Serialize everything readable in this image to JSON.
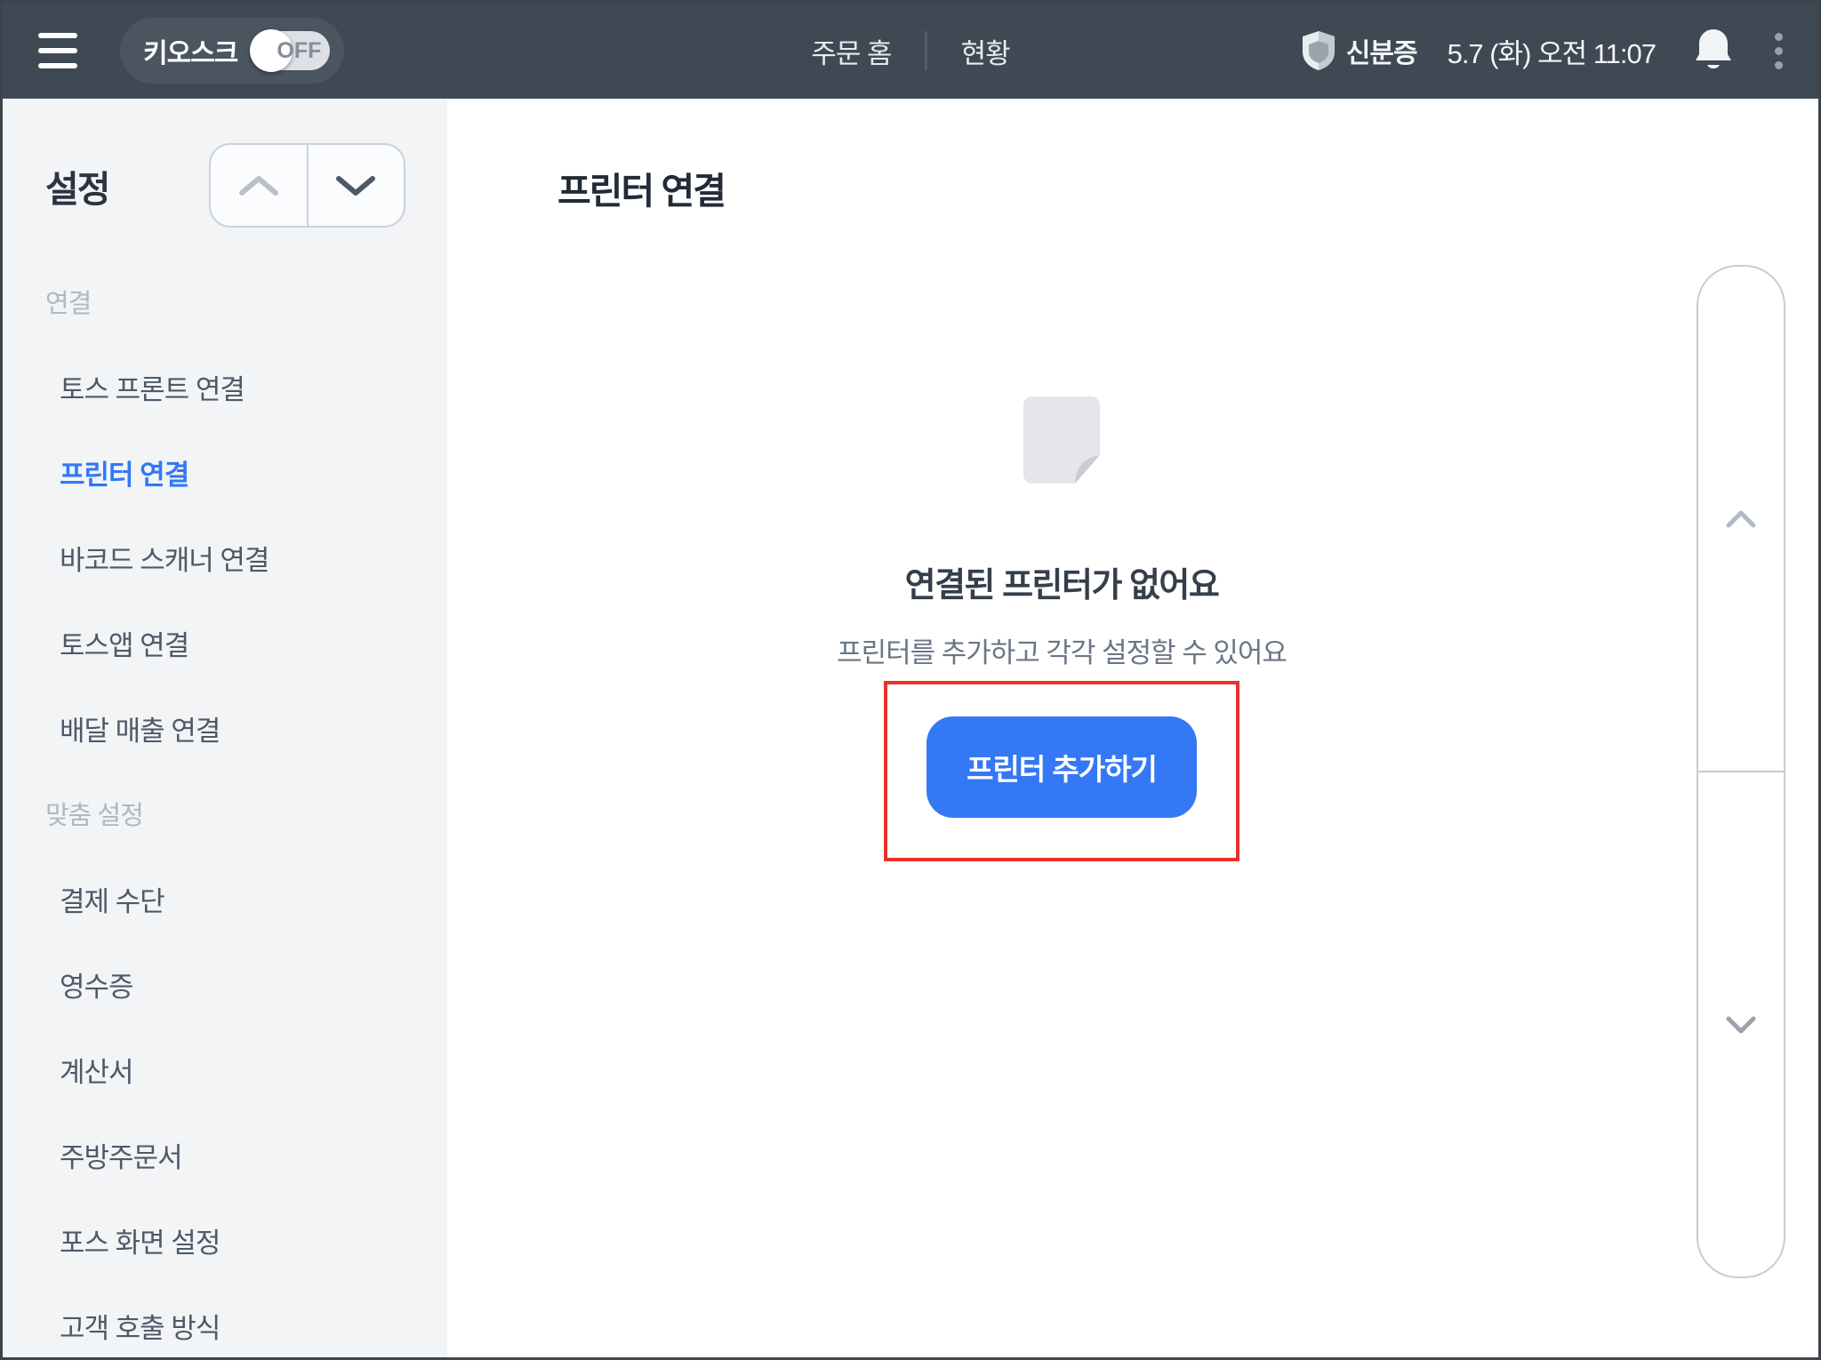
{
  "topbar": {
    "kiosk_label": "키오스크",
    "kiosk_state": "OFF",
    "nav_order_home": "주문 홈",
    "nav_status": "현황",
    "id_label": "신분증",
    "datetime": "5.7 (화) 오전 11:07"
  },
  "sidebar": {
    "title": "설정",
    "sections": [
      {
        "header": "연결",
        "items": [
          {
            "label": "토스 프론트 연결"
          },
          {
            "label": "프린터 연결",
            "active": true
          },
          {
            "label": "바코드 스캐너 연결"
          },
          {
            "label": "토스앱 연결"
          },
          {
            "label": "배달 매출 연결"
          }
        ]
      },
      {
        "header": "맞춤 설정",
        "items": [
          {
            "label": "결제 수단"
          },
          {
            "label": "영수증"
          },
          {
            "label": "계산서"
          },
          {
            "label": "주방주문서"
          },
          {
            "label": "포스 화면 설정"
          },
          {
            "label": "고객 호출 방식"
          }
        ]
      }
    ]
  },
  "main": {
    "title": "프린터 연결",
    "empty_state": {
      "heading": "연결된 프린터가 없어요",
      "subtitle": "프린터를 추가하고 각각 설정할 수 있어요",
      "add_button_label": "프린터 추가하기"
    }
  },
  "colors": {
    "topbar_bg": "#3e4954",
    "sidebar_bg": "#f2f4f6",
    "accent_blue": "#3578f5",
    "active_item_blue": "#3278f5",
    "annotation_red": "#e63329"
  },
  "icons": {
    "hamburger": "menu-icon",
    "shield": "id-shield-icon",
    "bell": "notification-bell-icon",
    "kebab": "more-menu-icon",
    "document": "empty-document-icon"
  }
}
